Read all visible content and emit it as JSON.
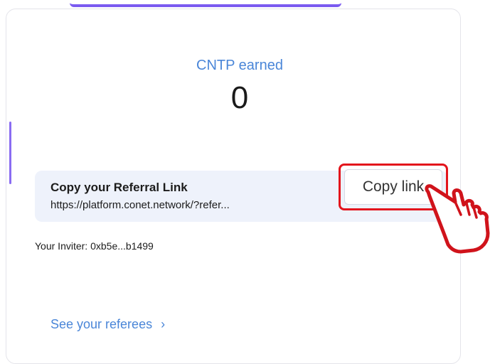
{
  "earned": {
    "label": "CNTP earned",
    "value": "0"
  },
  "referral": {
    "title": "Copy your Referral Link",
    "url": "https://platform.conet.network/?refer...",
    "copy_label": "Copy link"
  },
  "inviter": {
    "text": "Your Inviter: 0xb5e...b1499"
  },
  "referees": {
    "label": "See your referees",
    "chevron": "›"
  },
  "colors": {
    "accent_blue": "#4a86d8",
    "accent_purple": "#7a5af0",
    "highlight_red": "#e3141c"
  },
  "icons": {
    "pointer": "pointing-hand-icon",
    "chevron": "chevron-right-icon"
  }
}
